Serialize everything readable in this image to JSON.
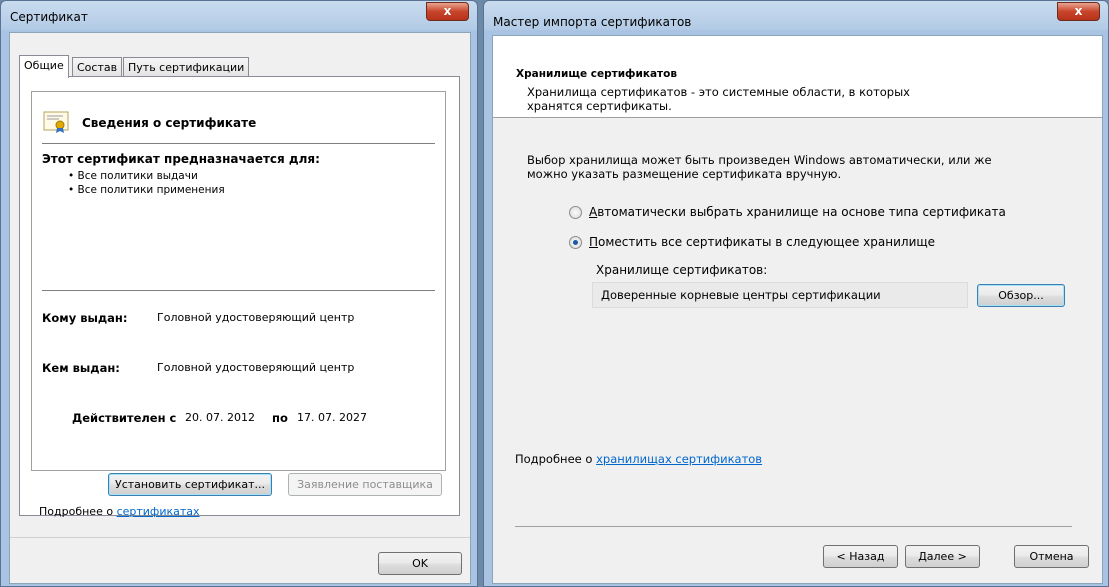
{
  "cert_window": {
    "title": "Сертификат",
    "close_label": "x",
    "tabs": [
      "Общие",
      "Состав",
      "Путь сертификации"
    ],
    "heading": "Сведения о сертификате",
    "purpose_title": "Этот сертификат предназначается для:",
    "purposes": [
      "• Все политики выдачи",
      "• Все политики применения"
    ],
    "issued_to_label": "Кому выдан:",
    "issued_to_value": "Головной удостоверяющий центр",
    "issued_by_label": "Кем выдан:",
    "issued_by_value": "Головной удостоверяющий центр",
    "valid_from_label": "Действителен с",
    "valid_from": "20. 07. 2012",
    "valid_to_label": "по",
    "valid_to": "17. 07. 2027",
    "install_button": "Установить сертификат...",
    "provider_button": "Заявление поставщика",
    "more_prefix": "Подробнее о",
    "more_link": "сертификатах",
    "ok_button": "OK"
  },
  "wizard_window": {
    "title": "Мастер импорта сертификатов",
    "close_label": "x",
    "header_title": "Хранилище сертификатов",
    "header_desc_line1": "Хранилища сертификатов - это системные области, в которых",
    "header_desc_line2": "хранятся сертификаты.",
    "body_line1": "Выбор хранилища может быть произведен Windows автоматически, или же",
    "body_line2": "можно указать размещение сертификата вручную.",
    "radio_auto_first": "А",
    "radio_auto_rest": "втоматически выбрать хранилище на основе типа сертификата",
    "radio_manual_first": "П",
    "radio_manual_rest": "оместить все сертификаты в следующее хранилище",
    "store_label": "Хранилище сертификатов:",
    "store_value": "Доверенные корневые центры сертификации",
    "browse_button": "Обзор...",
    "more_prefix": "Подробнее о",
    "more_link": "хранилищах сертификатов",
    "back_button": "< Назад",
    "next_button": "Далее >",
    "cancel_button": "Отмена"
  }
}
